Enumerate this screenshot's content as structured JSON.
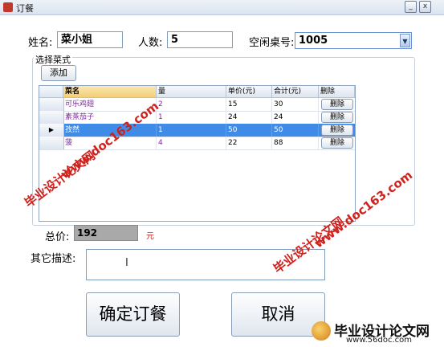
{
  "window": {
    "title": "订餐",
    "min_label": "_",
    "close_label": "x"
  },
  "form": {
    "name_label": "姓名:",
    "name_value": "菜小姐",
    "count_label": "人数:",
    "count_value": "5",
    "table_label": "空闲桌号:",
    "table_value": "1005",
    "dropdown_arrow": "▼"
  },
  "dishes": {
    "group_label": "选择菜式",
    "add_button": "添加",
    "columns": [
      "菜名",
      "量",
      "单价(元)",
      "合计(元)",
      "删除"
    ],
    "rows": [
      {
        "name": "可乐鸡翅",
        "qty": "2",
        "price": "15",
        "total": "30",
        "action": "删除"
      },
      {
        "name": "素蒸茄子",
        "qty": "1",
        "price": "24",
        "total": "24",
        "action": "删除"
      },
      {
        "name": "孜然",
        "qty": "1",
        "price": "50",
        "total": "50",
        "action": "删除"
      },
      {
        "name": "菠",
        "qty": "4",
        "price": "22",
        "total": "88",
        "action": "删除"
      }
    ],
    "current_row_marker": "▶"
  },
  "total": {
    "label": "总价:",
    "value": "192",
    "unit": "元"
  },
  "notes": {
    "label": "其它描述:",
    "cursor": "I"
  },
  "actions": {
    "confirm": "确定订餐",
    "cancel": "取消"
  },
  "watermarks": {
    "url": "www.doc163.com",
    "text": "毕业设计论文网",
    "footer_url": "www.56doc.com"
  },
  "colors": {
    "selected_row": "#3f8ce8",
    "watermark": "#d0211c",
    "unit": "#d0211c"
  }
}
